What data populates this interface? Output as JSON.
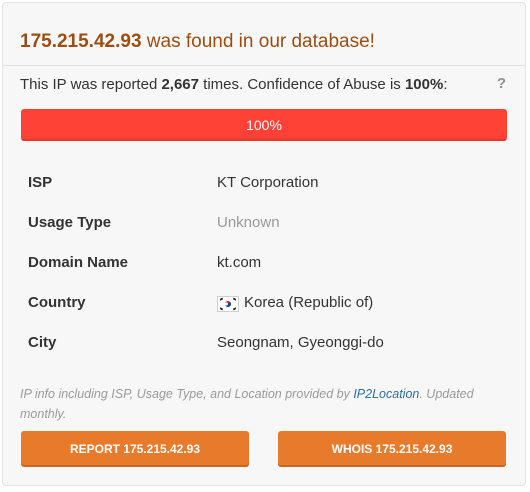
{
  "header": {
    "ip": "175.215.42.93",
    "found_text": " was found in our database!"
  },
  "report": {
    "prefix": "This IP was reported ",
    "count": "2,667",
    "middle": " times. Confidence of Abuse is ",
    "confidence": "100%",
    "suffix": ":",
    "help_icon": "?"
  },
  "confidence_bar": {
    "label": "100%",
    "fill_fraction": 1.0,
    "color": "#ff4136"
  },
  "info_rows": [
    {
      "key": "ISP",
      "value": "KT Corporation"
    },
    {
      "key": "Usage Type",
      "value": "Unknown"
    },
    {
      "key": "Domain Name",
      "value": "kt.com"
    },
    {
      "key": "Country",
      "value": "Korea (Republic of)",
      "icon": "south-korea-flag-icon"
    },
    {
      "key": "City",
      "value": "Seongnam, Gyeonggi-do"
    }
  ],
  "note": {
    "text": "IP info including ISP, Usage Type, and Location provided by ",
    "link": "IP2Location",
    "suffix": ". Updated monthly."
  },
  "buttons": {
    "report_label": "REPORT 175.215.42.93",
    "whois_label": "WHOIS 175.215.42.93"
  },
  "colors": {
    "accent": "#e87b2b",
    "title": "#9c4d11",
    "danger": "#ff4136"
  }
}
